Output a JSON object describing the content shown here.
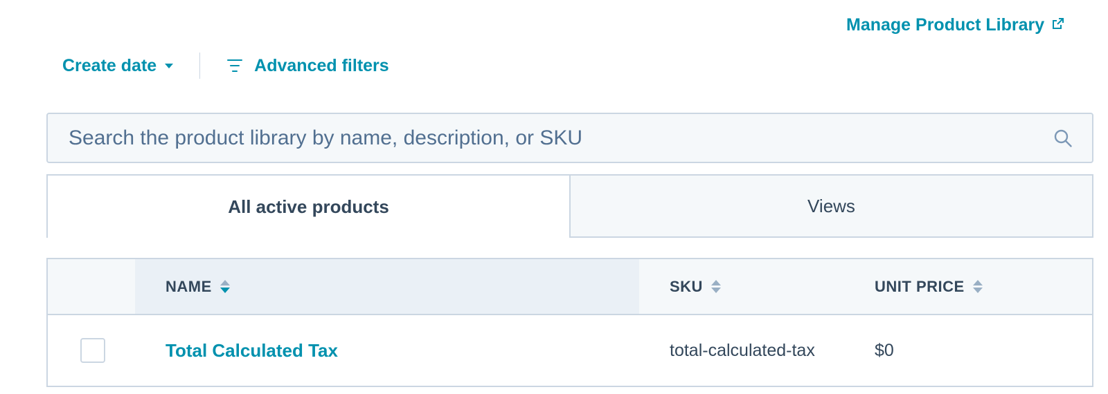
{
  "header": {
    "manage_link_label": "Manage Product Library",
    "manage_link_icon": "external-link-icon"
  },
  "filters": {
    "create_date_label": "Create date",
    "advanced_filters_label": "Advanced filters",
    "advanced_filters_icon": "filter-lines-icon"
  },
  "search": {
    "placeholder": "Search the product library by name, description, or SKU",
    "value": "",
    "icon": "search-icon"
  },
  "tabs": [
    {
      "label": "All active products",
      "active": true
    },
    {
      "label": "Views",
      "active": false
    }
  ],
  "table": {
    "columns": [
      {
        "label": "NAME",
        "sort": "descending"
      },
      {
        "label": "SKU",
        "sort": "none"
      },
      {
        "label": "UNIT PRICE",
        "sort": "none"
      }
    ],
    "rows": [
      {
        "checked": false,
        "name": "Total Calculated Tax",
        "sku": "total-calculated-tax",
        "unit_price": "$0"
      }
    ]
  },
  "colors": {
    "accent": "#0091ae",
    "text": "#33475b",
    "border": "#cbd6e2",
    "surface": "#f5f8fa",
    "sorted_column_bg": "#eaf0f6"
  }
}
